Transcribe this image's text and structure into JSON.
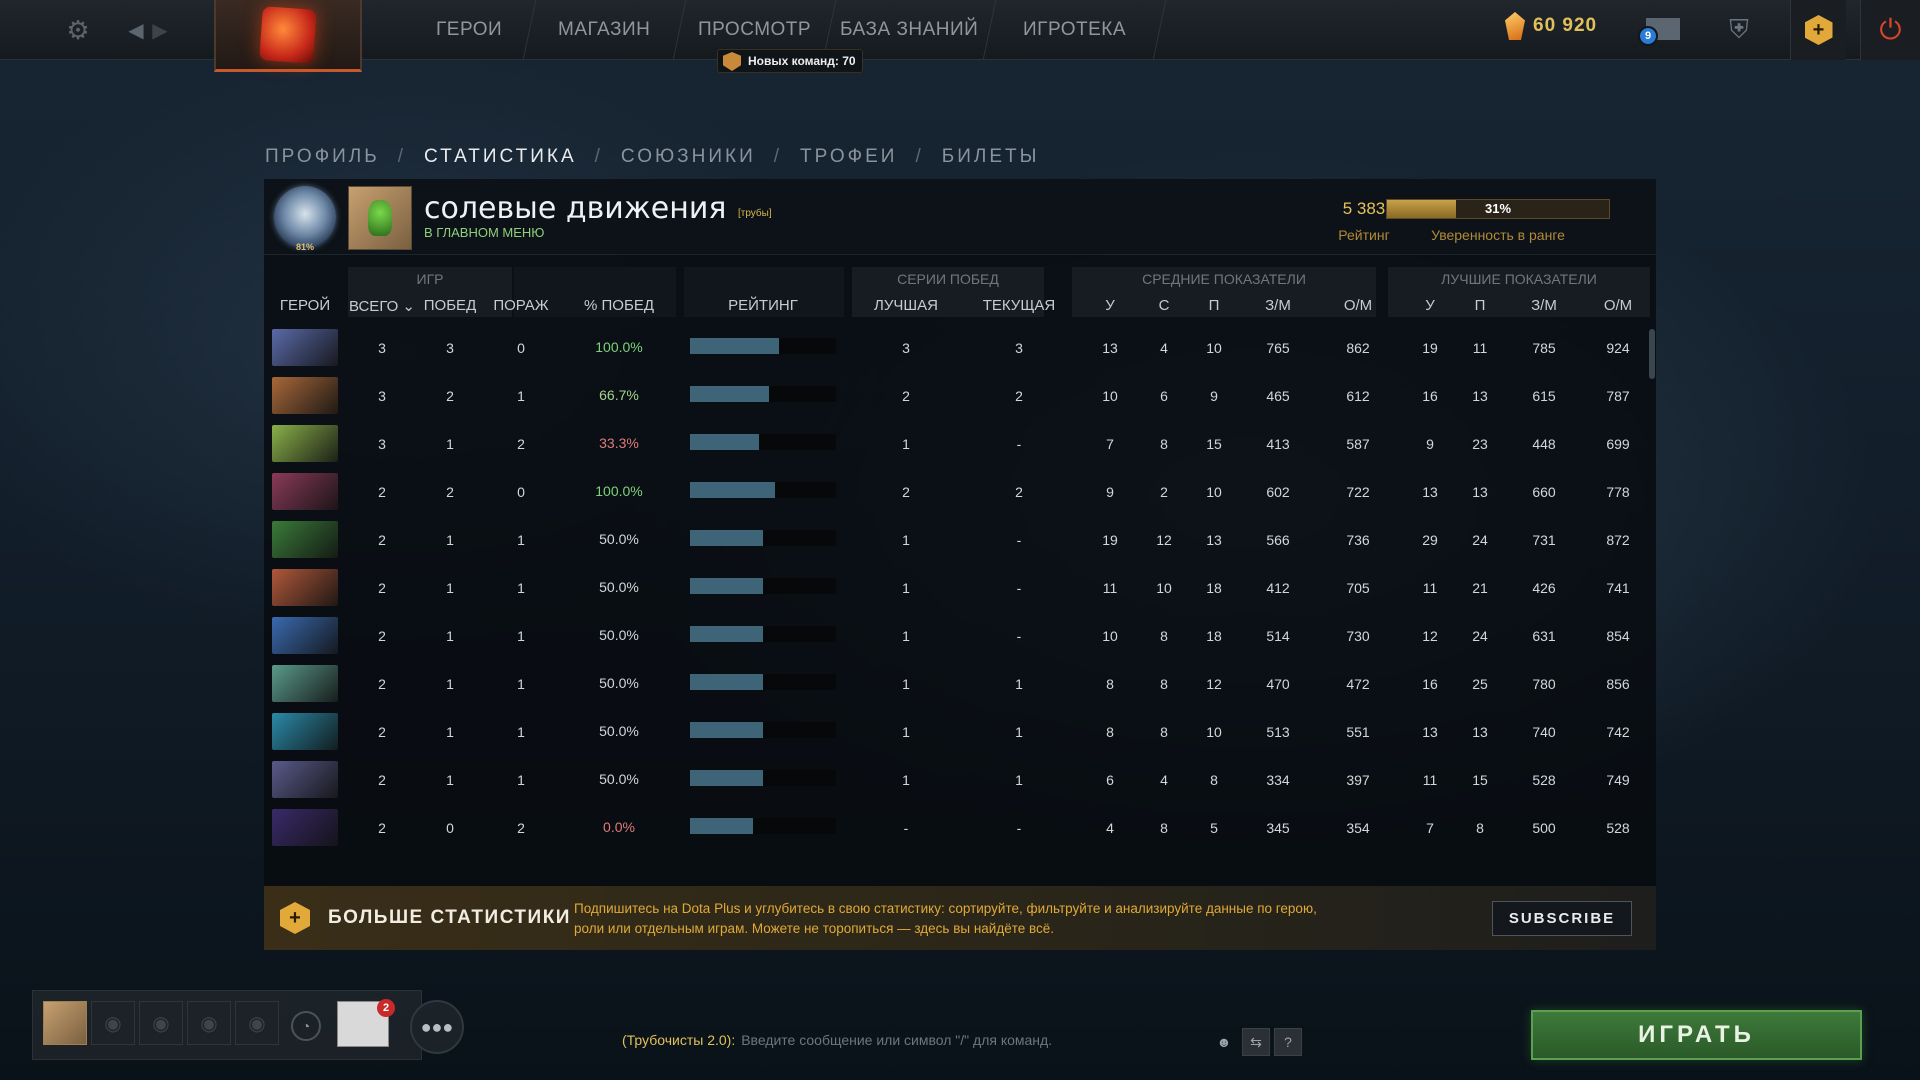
{
  "topbar": {
    "settings_icon": "gear-icon",
    "nav": [
      "ГЕРОИ",
      "МАГАЗИН",
      "ПРОСМОТР",
      "БАЗА ЗНАНИЙ",
      "ИГРОТЕКА"
    ],
    "new_commands": "Новых команд: 70",
    "shards": "60 920",
    "mail_count": "9"
  },
  "tabs": [
    "ПРОФИЛЬ",
    "СТАТИСТИКА",
    "СОЮЗНИКИ",
    "ТРОФЕИ",
    "БИЛЕТЫ"
  ],
  "tabs_active": 1,
  "profile": {
    "name": "солевые движения",
    "tag": "[трубы]",
    "status": "В ГЛАВНОМ МЕНЮ",
    "medal_pct": "81%",
    "rating": "5 383",
    "rating_label": "Рейтинг",
    "confidence": 31,
    "confidence_text": "31%",
    "confidence_label": "Уверенность в ранге"
  },
  "table": {
    "groups": {
      "games": "ИГР",
      "streaks": "СЕРИИ ПОБЕД",
      "avg": "СРЕДНИЕ ПОКАЗАТЕЛИ",
      "best": "ЛУЧШИЕ ПОКАЗАТЕЛИ"
    },
    "headers": {
      "hero": "ГЕРОЙ",
      "total": "ВСЕГО",
      "wins": "ПОБЕД",
      "losses": "ПОРАЖ",
      "winrate": "% ПОБЕД",
      "rating": "РЕЙТИНГ",
      "best_streak": "ЛУЧШАЯ",
      "current_streak": "ТЕКУЩАЯ",
      "avg_k": "У",
      "avg_d": "С",
      "avg_a": "П",
      "avg_gpm": "З/М",
      "avg_xpm": "О/М",
      "best_k": "У",
      "best_a": "П",
      "best_gpm": "З/М",
      "best_xpm": "О/М"
    },
    "rows": [
      {
        "hero_color": "#5a6aa8",
        "total": "3",
        "wins": "3",
        "losses": "0",
        "winrate": "100.0%",
        "wr_color": "#7ed27a",
        "rating_fill": 0.61,
        "best": "3",
        "current": "3",
        "ak": "13",
        "ad": "4",
        "aa": "10",
        "agpm": "765",
        "axpm": "862",
        "bk": "19",
        "ba": "11",
        "bgpm": "785",
        "bxpm": "924"
      },
      {
        "hero_color": "#a8683a",
        "total": "3",
        "wins": "2",
        "losses": "1",
        "winrate": "66.7%",
        "wr_color": "#a7d28a",
        "rating_fill": 0.54,
        "best": "2",
        "current": "2",
        "ak": "10",
        "ad": "6",
        "aa": "9",
        "agpm": "465",
        "axpm": "612",
        "bk": "16",
        "ba": "13",
        "bgpm": "615",
        "bxpm": "787"
      },
      {
        "hero_color": "#8ab04a",
        "total": "3",
        "wins": "1",
        "losses": "2",
        "winrate": "33.3%",
        "wr_color": "#e07a7a",
        "rating_fill": 0.47,
        "best": "1",
        "current": "-",
        "ak": "7",
        "ad": "8",
        "aa": "15",
        "agpm": "413",
        "axpm": "587",
        "bk": "9",
        "ba": "23",
        "bgpm": "448",
        "bxpm": "699"
      },
      {
        "hero_color": "#8a3a58",
        "total": "2",
        "wins": "2",
        "losses": "0",
        "winrate": "100.0%",
        "wr_color": "#7ed27a",
        "rating_fill": 0.58,
        "best": "2",
        "current": "2",
        "ak": "9",
        "ad": "2",
        "aa": "10",
        "agpm": "602",
        "axpm": "722",
        "bk": "13",
        "ba": "13",
        "bgpm": "660",
        "bxpm": "778"
      },
      {
        "hero_color": "#3a7a3a",
        "total": "2",
        "wins": "1",
        "losses": "1",
        "winrate": "50.0%",
        "wr_color": "#d2d7db",
        "rating_fill": 0.5,
        "best": "1",
        "current": "-",
        "ak": "19",
        "ad": "12",
        "aa": "13",
        "agpm": "566",
        "axpm": "736",
        "bk": "29",
        "ba": "24",
        "bgpm": "731",
        "bxpm": "872"
      },
      {
        "hero_color": "#b0583a",
        "total": "2",
        "wins": "1",
        "losses": "1",
        "winrate": "50.0%",
        "wr_color": "#d2d7db",
        "rating_fill": 0.5,
        "best": "1",
        "current": "-",
        "ak": "11",
        "ad": "10",
        "aa": "18",
        "agpm": "412",
        "axpm": "705",
        "bk": "11",
        "ba": "21",
        "bgpm": "426",
        "bxpm": "741"
      },
      {
        "hero_color": "#3a6ab0",
        "total": "2",
        "wins": "1",
        "losses": "1",
        "winrate": "50.0%",
        "wr_color": "#d2d7db",
        "rating_fill": 0.5,
        "best": "1",
        "current": "-",
        "ak": "10",
        "ad": "8",
        "aa": "18",
        "agpm": "514",
        "axpm": "730",
        "bk": "12",
        "ba": "24",
        "bgpm": "631",
        "bxpm": "854"
      },
      {
        "hero_color": "#5a9a8a",
        "total": "2",
        "wins": "1",
        "losses": "1",
        "winrate": "50.0%",
        "wr_color": "#d2d7db",
        "rating_fill": 0.5,
        "best": "1",
        "current": "1",
        "ak": "8",
        "ad": "8",
        "aa": "12",
        "agpm": "470",
        "axpm": "472",
        "bk": "16",
        "ba": "25",
        "bgpm": "780",
        "bxpm": "856"
      },
      {
        "hero_color": "#2a8aa8",
        "total": "2",
        "wins": "1",
        "losses": "1",
        "winrate": "50.0%",
        "wr_color": "#d2d7db",
        "rating_fill": 0.5,
        "best": "1",
        "current": "1",
        "ak": "8",
        "ad": "8",
        "aa": "10",
        "agpm": "513",
        "axpm": "551",
        "bk": "13",
        "ba": "13",
        "bgpm": "740",
        "bxpm": "742"
      },
      {
        "hero_color": "#5a5a8a",
        "total": "2",
        "wins": "1",
        "losses": "1",
        "winrate": "50.0%",
        "wr_color": "#d2d7db",
        "rating_fill": 0.5,
        "best": "1",
        "current": "1",
        "ak": "6",
        "ad": "4",
        "aa": "8",
        "agpm": "334",
        "axpm": "397",
        "bk": "11",
        "ba": "15",
        "bgpm": "528",
        "bxpm": "749"
      },
      {
        "hero_color": "#3a2a6a",
        "total": "2",
        "wins": "0",
        "losses": "2",
        "winrate": "0.0%",
        "wr_color": "#e07a7a",
        "rating_fill": 0.43,
        "best": "-",
        "current": "-",
        "ak": "4",
        "ad": "8",
        "aa": "5",
        "agpm": "345",
        "axpm": "354",
        "bk": "7",
        "ba": "8",
        "bgpm": "500",
        "bxpm": "528"
      }
    ]
  },
  "dota_plus": {
    "title": "БОЛЬШЕ СТАТИСТИКИ",
    "text": "Подпишитесь на Dota Plus и углубитесь в свою статистику: сортируйте, фильтруйте и анализируйте данные по герою, роли или отдельным играм. Можете не торопиться — здесь вы найдёте всё.",
    "button": "SUBSCRIBE"
  },
  "bottom": {
    "card_count": "2",
    "chat_channel": "(Трубочисты 2.0):",
    "chat_placeholder": "Введите сообщение или символ \"/\" для команд.",
    "play": "ИГРАТЬ"
  }
}
